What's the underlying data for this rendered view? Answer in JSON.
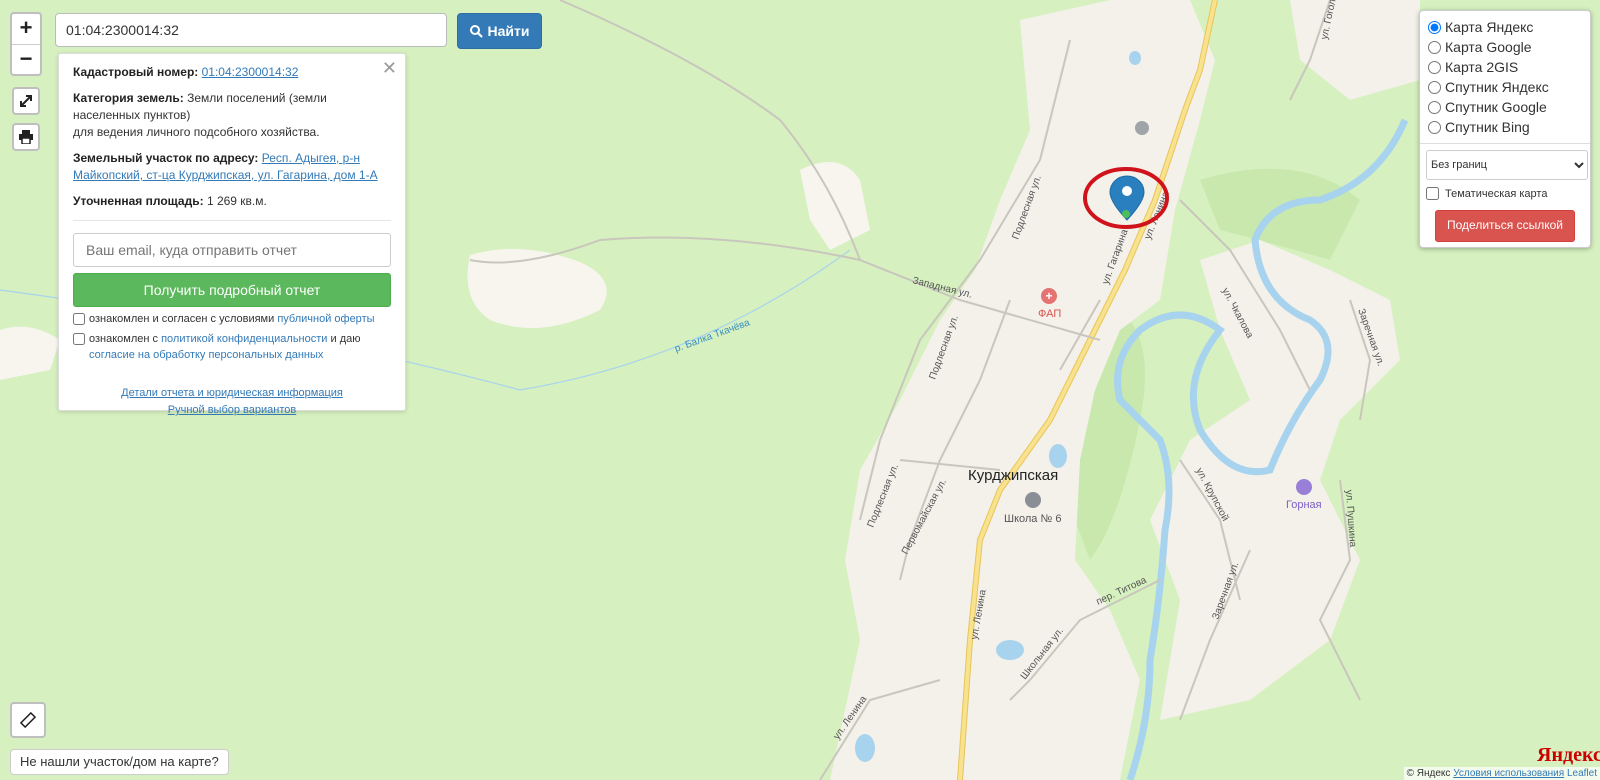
{
  "search": {
    "value": "01:04:2300014:32",
    "button_label": "Найти"
  },
  "info": {
    "cadastral_label": "Кадастровый номер:",
    "cadastral_value": "01:04:2300014:32",
    "category_label": "Категория земель:",
    "category_value": "Земли поселений (земли населенных пунктов)",
    "usage_value": "для ведения личного подсобного хозяйства.",
    "address_label": "Земельный участок по адресу:",
    "address_value": "Респ. Адыгея, р-н Майкопский, ст-ца Курджипская, ул. Гагарина, дом 1-А",
    "area_label": "Уточненная площадь:",
    "area_value": "1 269 кв.м.",
    "email_placeholder": "Ваш email, куда отправить отчет",
    "report_button": "Получить подробный отчет",
    "consent1_text": "ознакомлен и согласен с условиями",
    "consent1_link": "публичной оферты",
    "consent2_text": "ознакомлен с",
    "consent2_link": "политикой конфиденциальности",
    "consent2_mid": "и даю",
    "consent2_link2": "согласие на обработку персональных данных",
    "details_link": "Детали отчета и юридическая информация",
    "manual_link": "Ручной выбор вариантов"
  },
  "layers": {
    "options": [
      "Карта Яндекс",
      "Карта Google",
      "Карта 2GIS",
      "Спутник Яндекс",
      "Спутник Google",
      "Спутник Bing"
    ],
    "selected": "Карта Яндекс",
    "borders_selected": "Без границ",
    "theme_label": "Тематическая карта",
    "share_button": "Поделиться ссылкой"
  },
  "map": {
    "settlement": "Курджипская",
    "poi_fap": "ФАП",
    "poi_school": "Школа № 6",
    "poi_gornaya": "Горная",
    "river": "р. Балка Ткачёва",
    "streets": {
      "lenina": "ул. Ленина",
      "gagarina": "ул. Гагарина",
      "zapadnaya": "Западная ул.",
      "podlesnaya": "Подлесная ул.",
      "pervomayskaya": "Первомайская ул.",
      "chkalova": "ул. Чкалова",
      "krupskoy": "ул. Крупской",
      "titova": "пер. Титова",
      "shkolnaya": "Школьная ул.",
      "zarechnaya": "Заречная ул.",
      "pushkina": "ул. Пушкина",
      "gogolya": "ул. Гоголя"
    }
  },
  "footer": {
    "not_found": "Не нашли участок/дом на карте?",
    "attribution_yandex": "© Яндекс",
    "attribution_terms": "Условия использования",
    "logo": "Яндекс",
    "leaflet": "Leaflet"
  },
  "colors": {
    "land": "#d6f0bf",
    "settlement": "#f3f1ea",
    "river": "#a8d3ef",
    "main_road": "#f6d46a",
    "marker": "#2a7fbf",
    "highlight_circle": "#d0121b"
  }
}
